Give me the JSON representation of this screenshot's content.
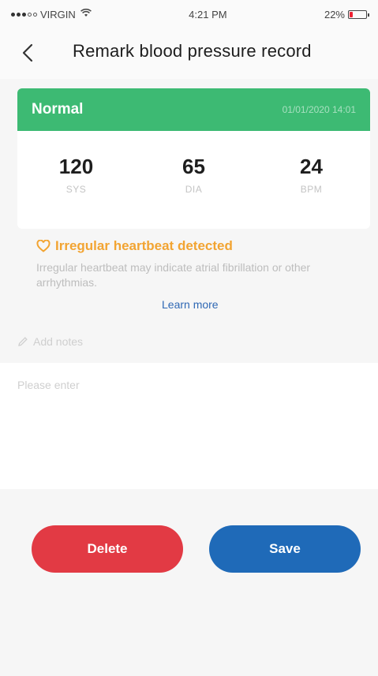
{
  "status_bar": {
    "carrier": "VIRGIN",
    "time": "4:21 PM",
    "battery": "22%",
    "battery_level": 0.22
  },
  "header": {
    "title": "Remark blood pressure record"
  },
  "record": {
    "status": "Normal",
    "datetime": "01/01/2020 14:01",
    "status_color": "#3dba73",
    "metrics": [
      {
        "value": "120",
        "unit": "SYS"
      },
      {
        "value": "65",
        "unit": "DIA"
      },
      {
        "value": "24",
        "unit": "BPM"
      }
    ]
  },
  "warning": {
    "icon": "heart-icon",
    "title": "Irregular heartbeat detected",
    "text": "Irregular heartbeat may indicate atrial fibrillation or other arrhythmias.",
    "learn_more": "Learn more",
    "color": "#f2a432"
  },
  "notes": {
    "label": "Add notes",
    "placeholder": "Please enter"
  },
  "buttons": {
    "delete": "Delete",
    "save": "Save",
    "delete_color": "#e23a44",
    "save_color": "#1f6ab8"
  }
}
